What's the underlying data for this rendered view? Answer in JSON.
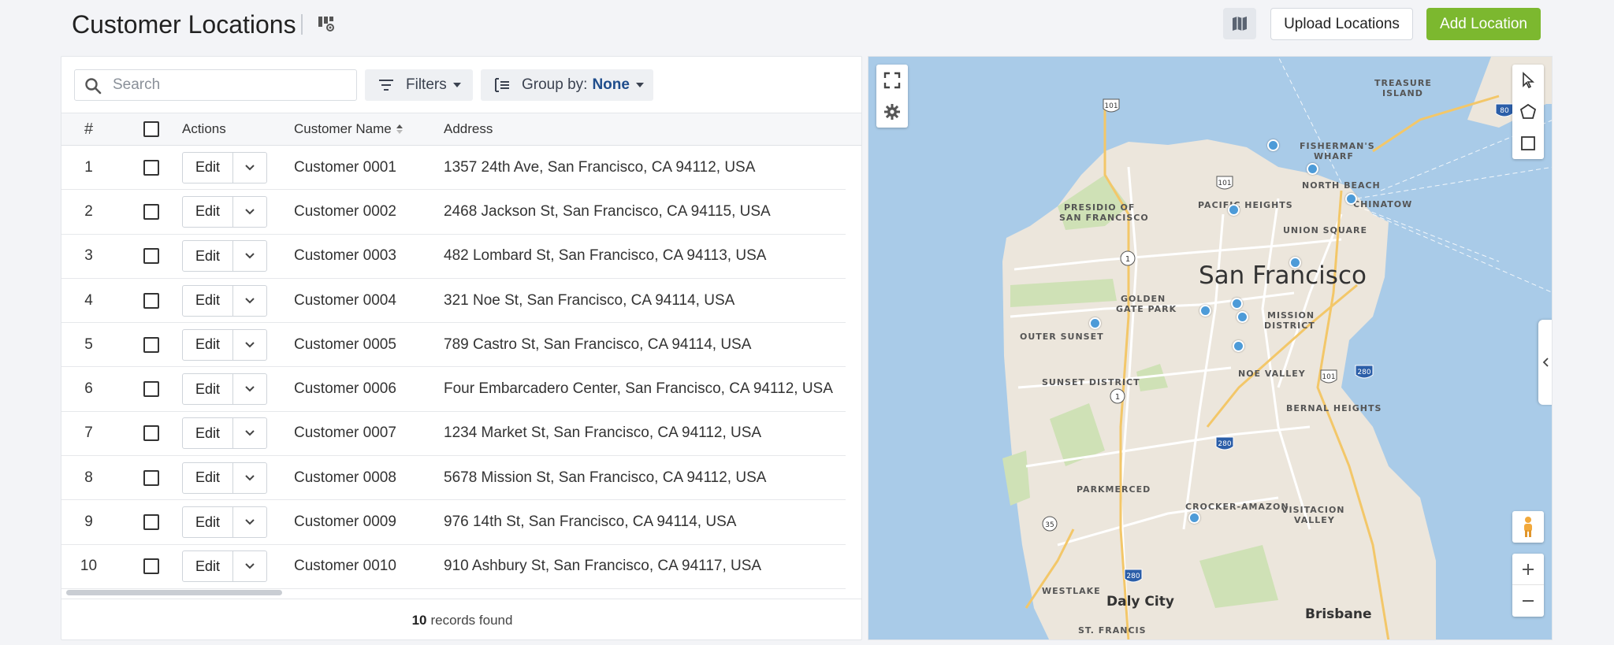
{
  "header": {
    "title": "Customer Locations",
    "upload_label": "Upload Locations",
    "add_label": "Add Location"
  },
  "toolbar": {
    "search_placeholder": "Search",
    "filters_label": "Filters",
    "group_by_label": "Group by:",
    "group_by_value": "None"
  },
  "table": {
    "columns": {
      "num": "#",
      "actions": "Actions",
      "name": "Customer Name",
      "address": "Address"
    },
    "edit_label": "Edit",
    "rows": [
      {
        "num": "1",
        "name": "Customer 0001",
        "address": "1357 24th Ave, San Francisco, CA 94112, USA"
      },
      {
        "num": "2",
        "name": "Customer 0002",
        "address": "2468 Jackson St, San Francisco, CA 94115, USA"
      },
      {
        "num": "3",
        "name": "Customer 0003",
        "address": "482 Lombard St, San Francisco, CA 94113, USA"
      },
      {
        "num": "4",
        "name": "Customer 0004",
        "address": "321 Noe St, San Francisco, CA 94114, USA"
      },
      {
        "num": "5",
        "name": "Customer 0005",
        "address": "789 Castro St, San Francisco, CA 94114, USA"
      },
      {
        "num": "6",
        "name": "Customer 0006",
        "address": "Four Embarcadero Center, San Francisco, CA 94112, USA"
      },
      {
        "num": "7",
        "name": "Customer 0007",
        "address": "1234 Market St, San Francisco, CA 94112, USA"
      },
      {
        "num": "8",
        "name": "Customer 0008",
        "address": "5678 Mission St, San Francisco, CA 94112, USA"
      },
      {
        "num": "9",
        "name": "Customer 0009",
        "address": "976 14th St, San Francisco, CA 94114, USA"
      },
      {
        "num": "10",
        "name": "Customer 0010",
        "address": "910 Ashbury St, San Francisco, CA 94117, USA"
      }
    ],
    "records_count": "10",
    "records_suffix": "records found"
  },
  "map": {
    "city": "San Francisco",
    "labels": {
      "treasure_island_1": "TREASURE",
      "treasure_island_2": "ISLAND",
      "fishermans_wharf_1": "FISHERMAN'S",
      "fishermans_wharf_2": "WHARF",
      "north_beach": "NORTH BEACH",
      "chinatown": "CHINATOW",
      "pacific_heights": "PACIFIC HEIGHTS",
      "presidio_1": "PRESIDIO OF",
      "presidio_2": "SAN FRANCISCO",
      "union_square": "UNION SQUARE",
      "golden_gate_1": "GOLDEN",
      "golden_gate_2": "GATE PARK",
      "mission_1": "MISSION",
      "mission_2": "DISTRICT",
      "outer_sunset": "OUTER SUNSET",
      "noe_valley": "NOE VALLEY",
      "sunset_district": "SUNSET DISTRICT",
      "bernal_heights": "BERNAL HEIGHTS",
      "parkmerced": "PARKMERCED",
      "crocker_amazon": "CROCKER-AMAZON",
      "visitacion_1": "VISITACION",
      "visitacion_2": "VALLEY",
      "westlake": "WESTLAKE",
      "daly_city": "Daly City",
      "brisbane": "Brisbane",
      "st_francis": "ST. FRANCIS"
    },
    "highway_shields": [
      "101",
      "101",
      "1",
      "1",
      "101",
      "280",
      "280",
      "280",
      "35",
      "80"
    ],
    "colors": {
      "water": "#a9cbe8",
      "land": "#ece6dc",
      "park": "#cfe1b6",
      "pin": "#4d9bd8",
      "accent_green": "#7cb82f"
    }
  }
}
